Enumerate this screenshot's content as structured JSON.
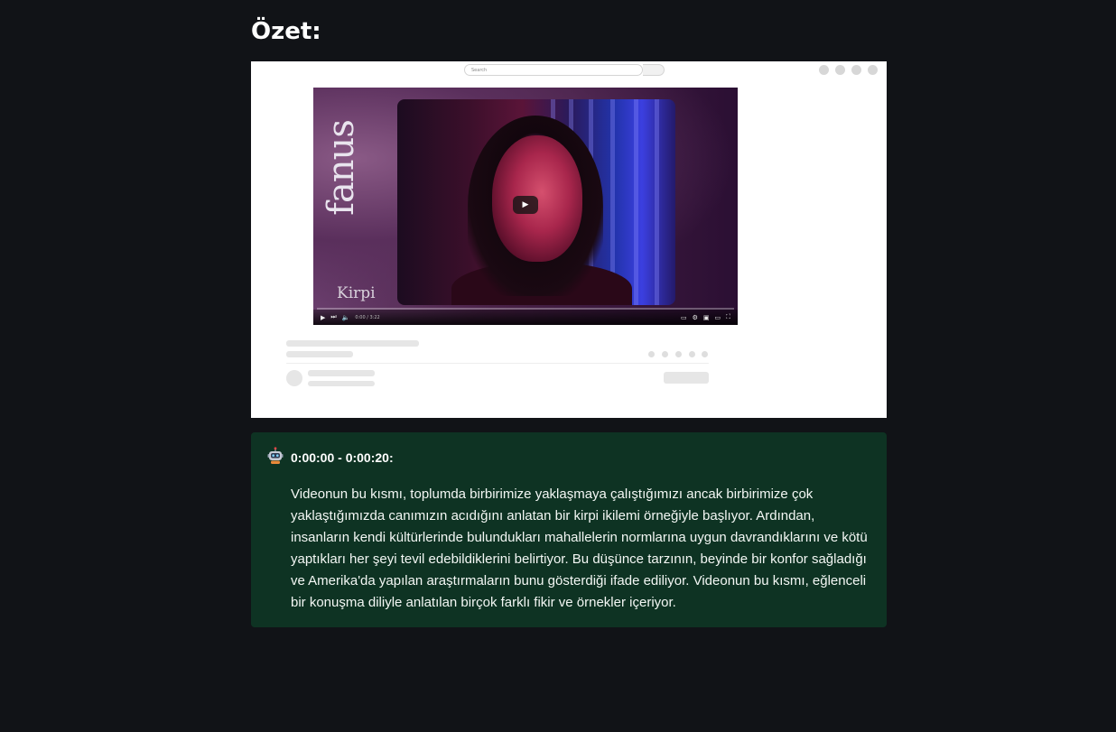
{
  "page": {
    "title": "Özet:"
  },
  "thumbnail": {
    "search_placeholder": "Search",
    "brand_text": "fanus",
    "corner_text": "Kirpi",
    "time": "0:00 / 3:22"
  },
  "summary": {
    "timestamp": "0:00:00 - 0:00:20:",
    "text": "Videonun bu kısmı, toplumda birbirimize yaklaşmaya çalıştığımızı ancak birbirimize çok yaklaştığımızda canımızın acıdığını anlatan bir kirpi ikilemi örneğiyle başlıyor. Ardından, insanların kendi kültürlerinde bulundukları mahallelerin normlarına uygun davrandıklarını ve kötü yaptıkları her şeyi tevil edebildiklerini belirtiyor. Bu düşünce tarzının, beyinde bir konfor sağladığı ve Amerika'da yapılan araştırmaların bunu gösterdiği ifade ediliyor. Videonun bu kısmı, eğlenceli bir konuşma diliyle anlatılan birçok farklı fikir ve örnekler içeriyor.",
    "icon": "robot-icon"
  },
  "colors": {
    "background": "#111317",
    "summary_bg": "#0e3323",
    "text": "#ffffff"
  }
}
